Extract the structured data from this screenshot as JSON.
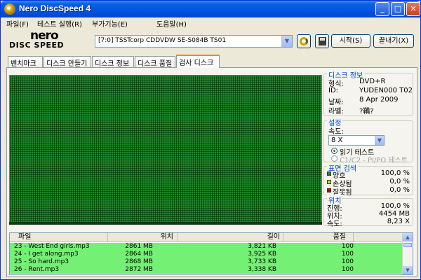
{
  "window": {
    "title": "Nero DiscSpeed 4"
  },
  "titlebar_buttons": {
    "minimize": "_",
    "maximize": "□",
    "close": "✕"
  },
  "menubar": {
    "items": [
      "파일(F)",
      "테스트 실행(R)",
      "부가기능(E)",
      "도움말(H)"
    ]
  },
  "logo": {
    "top": "nero",
    "bottom": "DISC SPEED"
  },
  "toolbar": {
    "drive": "[7:0]  TSSTcorp CDDVDW SE-S084B TS01",
    "dropdown_glyph": "▼",
    "start_label": "시작(S)",
    "exit_label": "끝내기(X)"
  },
  "tabs": [
    "벤치마크",
    "디스크 만들기",
    "디스크 정보",
    "디스크 품질",
    "검사 디스크"
  ],
  "active_tab": "검사 디스크",
  "disc_info": {
    "title": "디스크 정보",
    "rows": [
      {
        "label": "형식:",
        "value": "DVD+R"
      },
      {
        "label": "ID:",
        "value": "YUDEN000 T02"
      },
      {
        "label": "날짜:",
        "value": "8 Apr 2009"
      },
      {
        "label": "라벨:",
        "value": "?鞴?"
      }
    ]
  },
  "settings": {
    "title": "설정",
    "speed_label": "속도:",
    "speed_value": "8 X",
    "option_read_test": "읽기 테스트",
    "option_c1c2": "C1/C2 - PI/PO 테스트"
  },
  "surface_scan": {
    "title": "표면 검색",
    "rows": [
      {
        "label": "양호",
        "value": "100,0 %",
        "color": "#1e8a2a"
      },
      {
        "label": "손상됨",
        "value": "0,0 %",
        "color": "#e8d400"
      },
      {
        "label": "잘못됨",
        "value": "0,0 %",
        "color": "#c00000"
      }
    ]
  },
  "position": {
    "title": "위치",
    "rows": [
      {
        "label": "진행:",
        "value": "100,0 %"
      },
      {
        "label": "위치:",
        "value": "4454 MB"
      },
      {
        "label": "속도:",
        "value": "8,23 X"
      }
    ]
  },
  "track_list": {
    "headers": {
      "name": "파일",
      "pos": "위치",
      "len": "길이",
      "quality": "품질"
    },
    "rows": [
      {
        "name": "23 - West End girls.mp3",
        "pos": "2861 MB",
        "len": "3,821 KB",
        "quality": "100"
      },
      {
        "name": "24 - I get along.mp3",
        "pos": "2864 MB",
        "len": "3,925 KB",
        "quality": "100"
      },
      {
        "name": "25 - So hard.mp3",
        "pos": "2868 MB",
        "len": "3,733 KB",
        "quality": "100"
      },
      {
        "name": "26 - Rent.mp3",
        "pos": "2872 MB",
        "len": "3,338 KB",
        "quality": "100"
      }
    ],
    "row_color": "#74f074"
  }
}
